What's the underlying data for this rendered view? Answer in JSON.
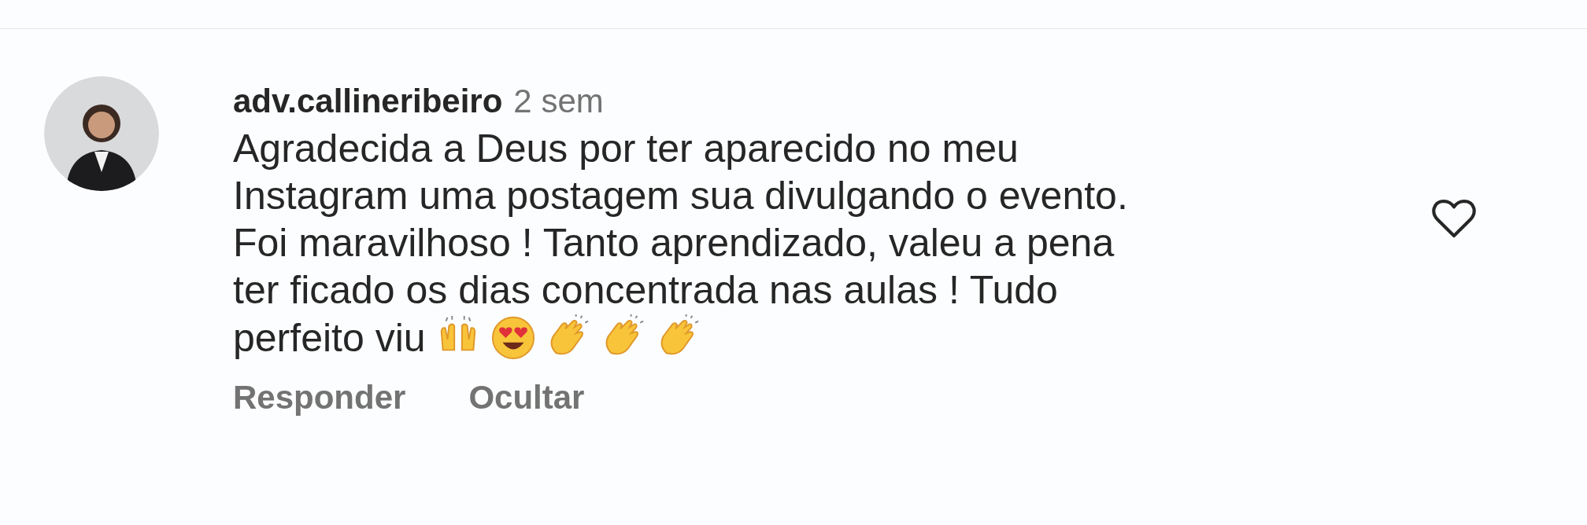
{
  "comment": {
    "username": "adv.callineribeiro",
    "time": "2 sem",
    "lines": [
      "Agradecida a Deus por ter aparecido no meu",
      "Instagram uma postagem sua divulgando o evento.",
      "Foi maravilhoso ! Tanto aprendizado, valeu a pena",
      "ter ficado os dias concentrada nas aulas ! Tudo",
      "perfeito viu"
    ],
    "emojis": [
      {
        "kind": "raising-hands"
      },
      {
        "kind": "heart-eyes"
      },
      {
        "kind": "clap"
      },
      {
        "kind": "clap"
      },
      {
        "kind": "clap"
      }
    ],
    "liked": false,
    "actions": [
      "Responder",
      "Ocultar"
    ]
  }
}
